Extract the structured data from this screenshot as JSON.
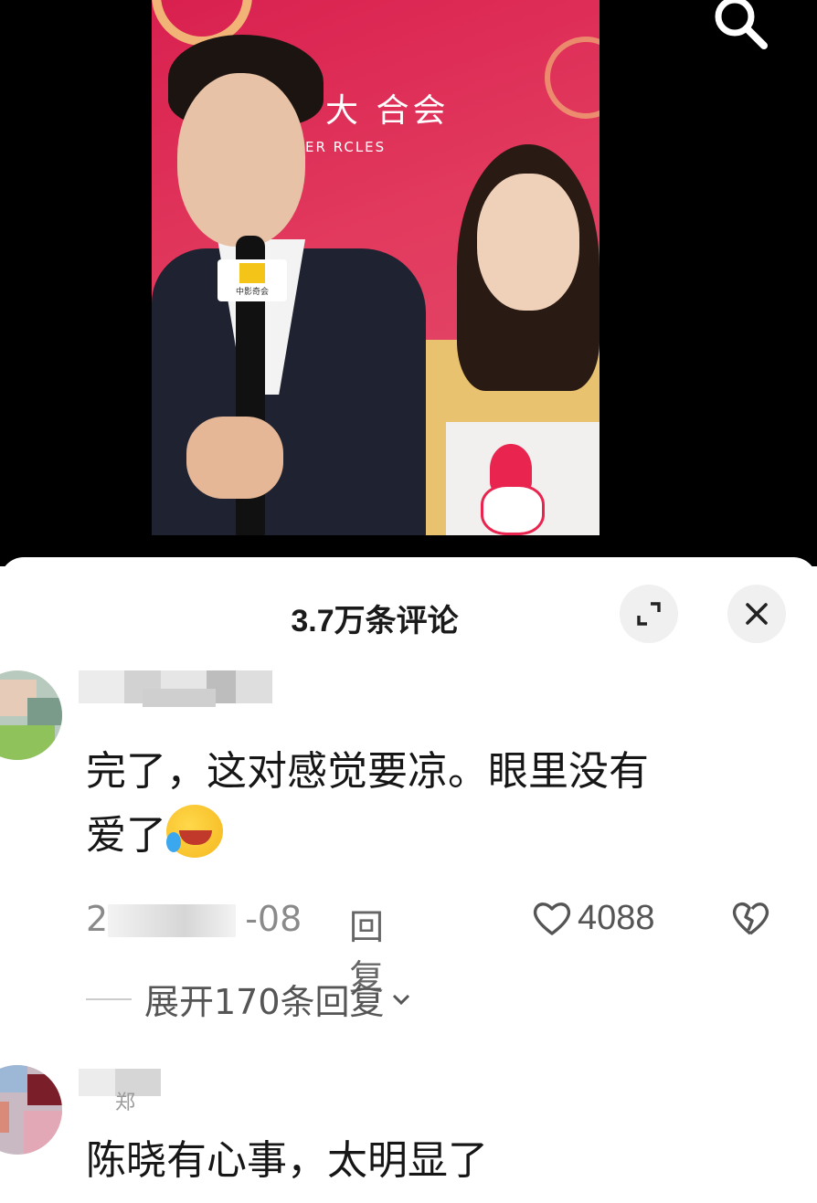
{
  "video": {
    "backdrop_text": "大  合会",
    "backdrop_sub": "ER       RCLES",
    "mic_flag": "中影奇会"
  },
  "comments_sheet": {
    "title": "3.7万条评论",
    "comments": [
      {
        "text_line1": "完了，这对感觉要凉。眼里没有",
        "text_line2": "爱了",
        "emoji": "rofl-emoji",
        "date_prefix": "2",
        "date_suffix": "-08",
        "reply_label": "回复",
        "likes": "4088",
        "expand_label": "展开170条回复"
      },
      {
        "username_fragment": "郑",
        "text_line1": "陈晓有心事，太明显了"
      }
    ]
  },
  "colors": {
    "backdrop_red": "#d9204f",
    "gold": "#f3c47a",
    "sheet_bg": "#ffffff",
    "text_primary": "#161616",
    "text_secondary": "#8a8a8a"
  }
}
